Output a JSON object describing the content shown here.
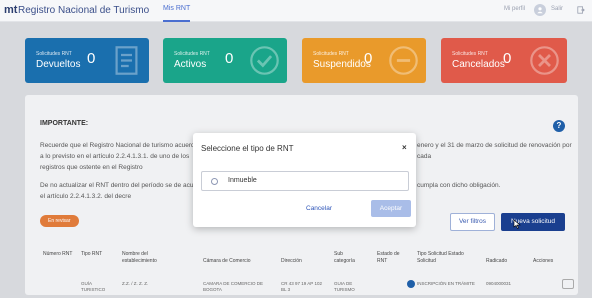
{
  "header": {
    "logo": "mt",
    "title": "Registro Nacional de Turismo",
    "nav_tab": "Mis RNT",
    "profile_link": "Mi perfil",
    "user_name": "Salir",
    "avatar_icon": "user-icon",
    "exit_icon": "exit-icon"
  },
  "cards": [
    {
      "label": "Solicitudes RNT",
      "state": "Devueltos",
      "count": "0",
      "color": "#1a6fae",
      "icon": "document-icon"
    },
    {
      "label": "Solicitudes RNT",
      "state": "Activos",
      "count": "0",
      "color": "#1aa58a",
      "icon": "check-circle-icon"
    },
    {
      "label": "Solicitudes RNT",
      "state": "Suspendidos",
      "count": "0",
      "color": "#e99a2b",
      "icon": "minus-circle-icon"
    },
    {
      "label": "Solicitudes RNT",
      "state": "Cancelados",
      "count": "0",
      "color": "#e05a4a",
      "icon": "cancel-circle-icon"
    }
  ],
  "panel": {
    "title": "IMPORTANTE:",
    "text_left_1": "Recuerde que el Registro Nacional de turismo acuerdo a lo previsto en el artículo 2.2.4.1.3.1. de uno de los registros que ostente en el Registro",
    "text_right_1": "enero y el 31 de marzo de solicitud de renovación por cada",
    "text_left_2": "De no actualizar el RNT dentro del período se de acuerdo con el artículo 2.2.4.1.3.2. del decre",
    "text_right_2": "cumpla con dicho obligación.",
    "pill": "En revisar",
    "filter_button": "Ver filtros",
    "new_button": "Nueva solicitud"
  },
  "table": {
    "headers": [
      "Número RNT",
      "Tipo RNT",
      "Nombre del establecimiento",
      "Cámara de Comercio",
      "Dirección",
      "Sub categoría",
      "Estado de RNT",
      "Tipo Solicitud Estado Solicitud",
      "Radicado",
      "Acciones"
    ],
    "row": [
      "",
      "GUÍA TURISTICO",
      "Z.Z. / Z. Z. Z.",
      "CAMARA DE COMERCIO DE BOGOTA",
      "CR 43 97 19 AP 102 BL 3",
      "GUIA DE TURISMO",
      "",
      "INSCRIPCIÓN EN TRÁMITE",
      "0904000031",
      ""
    ]
  },
  "modal": {
    "title": "Seleccione el tipo de RNT",
    "close": "×",
    "option": "Inmueble",
    "cancel": "Cancelar",
    "accept": "Aceptar"
  }
}
